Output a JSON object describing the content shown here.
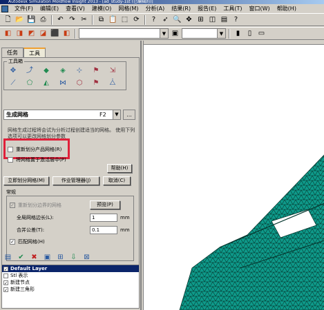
{
  "title": "Autodesk Simulation Moldflow Insight 2013 - [ad_study-1st (已编辑的)]",
  "menu": [
    "文件(F)",
    "编辑(E)",
    "查看(V)",
    "建模(O)",
    "网格(M)",
    "分析(A)",
    "结果(R)",
    "报告(E)",
    "工具(T)",
    "窗口(W)",
    "帮助(H)"
  ],
  "tabs": [
    "任务",
    "工具"
  ],
  "group_label": "工具箱",
  "icons_row1": [
    "mesh-tool-icon",
    "curve-tool-icon",
    "surface-tool-icon",
    "solid-tool-icon",
    "node-tool-icon",
    "element-tool-icon",
    "move-tool-icon"
  ],
  "icons_row2": [
    "line-tool-icon",
    "region-tool-icon",
    "fill-tool-icon",
    "edge-tool-icon",
    "merge-tool-icon",
    "delete-tool-icon",
    "tet-tool-icon"
  ],
  "tool": {
    "name": "生成网格",
    "hotkey": "F2",
    "dots": "...",
    "description": "网格生成过程将会试为分析过程创建适当的网格。 使用下列选项可以更改网格划分参数",
    "remesh_label": "重新划分产品网格(R)",
    "place_active_label": "将网格置于激活层中(P)",
    "help_btn": "帮助(H)",
    "mesh_now_btn": "立即划分网格(M)",
    "job_manager_btn": "作业管理器(J)",
    "cancel_btn": "取消(C)",
    "subtab": "常规",
    "remesh_boundary_label": "重新划分边界的网格",
    "preview_btn": "预览(P)",
    "edge_length_label": "全局网格边长(L):",
    "edge_length_value": "1",
    "tolerance_label": "合并公差(T):",
    "tolerance_value": "0.1",
    "unit_mm": "mm",
    "match_mesh_label": "匹配网格(H)"
  },
  "layers": [
    {
      "name": "Default Layer",
      "checked": true,
      "selected": true
    },
    {
      "name": "Stl 表示",
      "checked": false,
      "selected": false
    },
    {
      "name": "新建节点",
      "checked": true,
      "selected": false
    },
    {
      "name": "新建三角形",
      "checked": true,
      "selected": false
    }
  ],
  "colors": {
    "mesh_fill": "#0e9a8a",
    "mesh_edge": "#06372f",
    "highlight": "#e0203a",
    "layer_selected": "#0a246a"
  }
}
